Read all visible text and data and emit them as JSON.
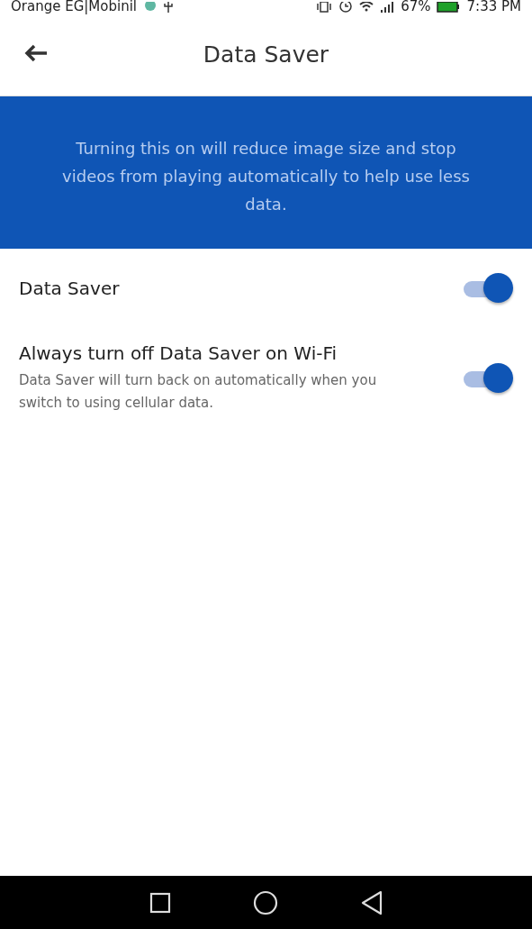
{
  "status_bar": {
    "carrier": "Orange EG|Mobinil",
    "battery": "67%",
    "time": "7:33 PM"
  },
  "header": {
    "title": "Data Saver"
  },
  "banner": {
    "text": "Turning this on will reduce image size and stop videos from playing automatically to help use less data."
  },
  "settings": [
    {
      "label": "Data Saver",
      "on": true
    },
    {
      "label": "Always turn off Data Saver on Wi-Fi",
      "description": "Data Saver will turn back on automatically when you switch to using cellular data.",
      "on": true
    }
  ]
}
